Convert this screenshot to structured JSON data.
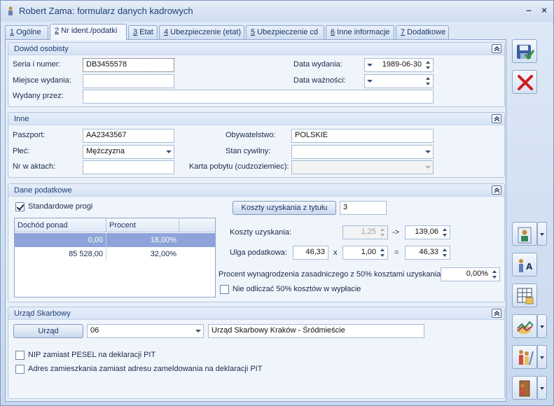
{
  "window": {
    "title": "Robert Zama: formularz danych kadrowych",
    "minimize": "–",
    "close": "×"
  },
  "tabs": [
    {
      "key": "1",
      "label": " Ogólne"
    },
    {
      "key": "2",
      "label": " Nr ident./podatki"
    },
    {
      "key": "3",
      "label": " Etat"
    },
    {
      "key": "4",
      "label": " Ubezpieczenie (etat)"
    },
    {
      "key": "5",
      "label": " Ubezpieczenie cd"
    },
    {
      "key": "6",
      "label": " Inne informacje"
    },
    {
      "key": "7",
      "label": " Dodatkowe"
    }
  ],
  "dowod": {
    "title": "Dowód osobisty",
    "seria_label": "Seria i numer:",
    "seria_value": "DB3455578",
    "miejsce_label": "Miejsce wydania:",
    "miejsce_value": "",
    "wydany_label": "Wydany przez:",
    "wydany_value": "",
    "data_wydania_label": "Data wydania:",
    "data_wydania_value": "1989-06-30",
    "data_waznosci_label": "Data ważności:",
    "data_waznosci_value": ""
  },
  "inne": {
    "title": "Inne",
    "paszport_label": "Paszport:",
    "paszport_value": "AA2343567",
    "plec_label": "Płeć:",
    "plec_value": "Mężczyzna",
    "nr_akt_label": "Nr w aktach:",
    "nr_akt_value": "",
    "obyw_label": "Obywatelstwo:",
    "obyw_value": "POLSKIE",
    "stan_label": "Stan cywilny:",
    "stan_value": "",
    "karta_label": "Karta pobytu (cudzoziemiec):",
    "karta_value": ""
  },
  "podatki": {
    "title": "Dane podatkowe",
    "standard_label": "Standardowe progi",
    "standard_checked": true,
    "grid_headers": [
      "Dochód ponad",
      "Procent"
    ],
    "grid_rows": [
      {
        "dochod": "0,00",
        "procent": "18,00%"
      },
      {
        "dochod": "85 528,00",
        "procent": "32,00%"
      }
    ],
    "koszty_button": "Koszty uzyskania z tytułu",
    "koszty_count": "3",
    "koszty_label": "Koszty uzyskania:",
    "koszty_value1": "1,25",
    "arrow": "->",
    "koszty_value2": "139,06",
    "ulga_label": "Ulga podatkowa:",
    "ulga_value1": "46,33",
    "times": "x",
    "ulga_value2": "1,00",
    "equals": "=",
    "ulga_value3": "46,33",
    "procent_label": "Procent wynagrodzenia zasadniczego z 50% kosztami uzyskania:",
    "procent_value": "0,00%",
    "nie_odliczac_label": "Nie odliczać 50% kosztów w wypłacie"
  },
  "urzad": {
    "title": "Urząd Skarbowy",
    "button": "Urząd",
    "code": "06",
    "name": "Urząd Skarbowy Kraków - Śródmieście",
    "nip_label": "NIP zamiast PESEL na deklaracji PIT",
    "adres_label": "Adres zamieszkania zamiast adresu zameldowania na deklaracji PIT"
  },
  "colors": {
    "accent": "#1f3e74",
    "selected_row": "#8ea4d8",
    "save_green": "#2e9a2e",
    "cancel_red": "#d01c1c"
  }
}
